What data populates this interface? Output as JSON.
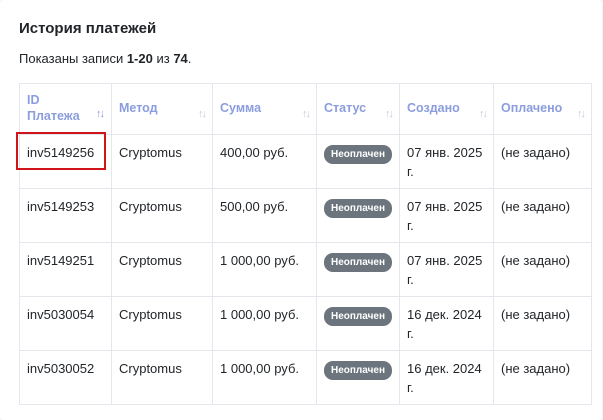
{
  "page": {
    "title": "История платежей",
    "summary": {
      "prefix": "Показаны записи ",
      "range": "1-20",
      "middle": " из ",
      "total": "74",
      "suffix": "."
    }
  },
  "table": {
    "columns": [
      {
        "label": "ID Платежа",
        "sort": "asc"
      },
      {
        "label": "Метод",
        "sort": "none"
      },
      {
        "label": "Сумма",
        "sort": "none"
      },
      {
        "label": "Статус",
        "sort": "none"
      },
      {
        "label": "Создано",
        "sort": "none"
      },
      {
        "label": "Оплачено",
        "sort": "none"
      }
    ],
    "rows": [
      {
        "id": "inv5149256",
        "method": "Cryptomus",
        "amount": "400,00 руб.",
        "status": "Неоплачен",
        "created": "07 янв. 2025 г.",
        "paid": "(не задано)"
      },
      {
        "id": "inv5149253",
        "method": "Cryptomus",
        "amount": "500,00 руб.",
        "status": "Неоплачен",
        "created": "07 янв. 2025 г.",
        "paid": "(не задано)"
      },
      {
        "id": "inv5149251",
        "method": "Cryptomus",
        "amount": "1 000,00 руб.",
        "status": "Неоплачен",
        "created": "07 янв. 2025 г.",
        "paid": "(не задано)"
      },
      {
        "id": "inv5030054",
        "method": "Cryptomus",
        "amount": "1 000,00 руб.",
        "status": "Неоплачен",
        "created": "16 дек. 2024 г.",
        "paid": "(не задано)"
      },
      {
        "id": "inv5030052",
        "method": "Cryptomus",
        "amount": "1 000,00 руб.",
        "status": "Неоплачен",
        "created": "16 дек. 2024 г.",
        "paid": "(не задано)"
      }
    ]
  },
  "icons": {
    "sort_asc": "sort-asc-icon",
    "sort_none": "sort-icon"
  },
  "colors": {
    "header_text": "#8b9dde",
    "badge_bg": "#6c757d",
    "highlight": "#d0141c"
  }
}
